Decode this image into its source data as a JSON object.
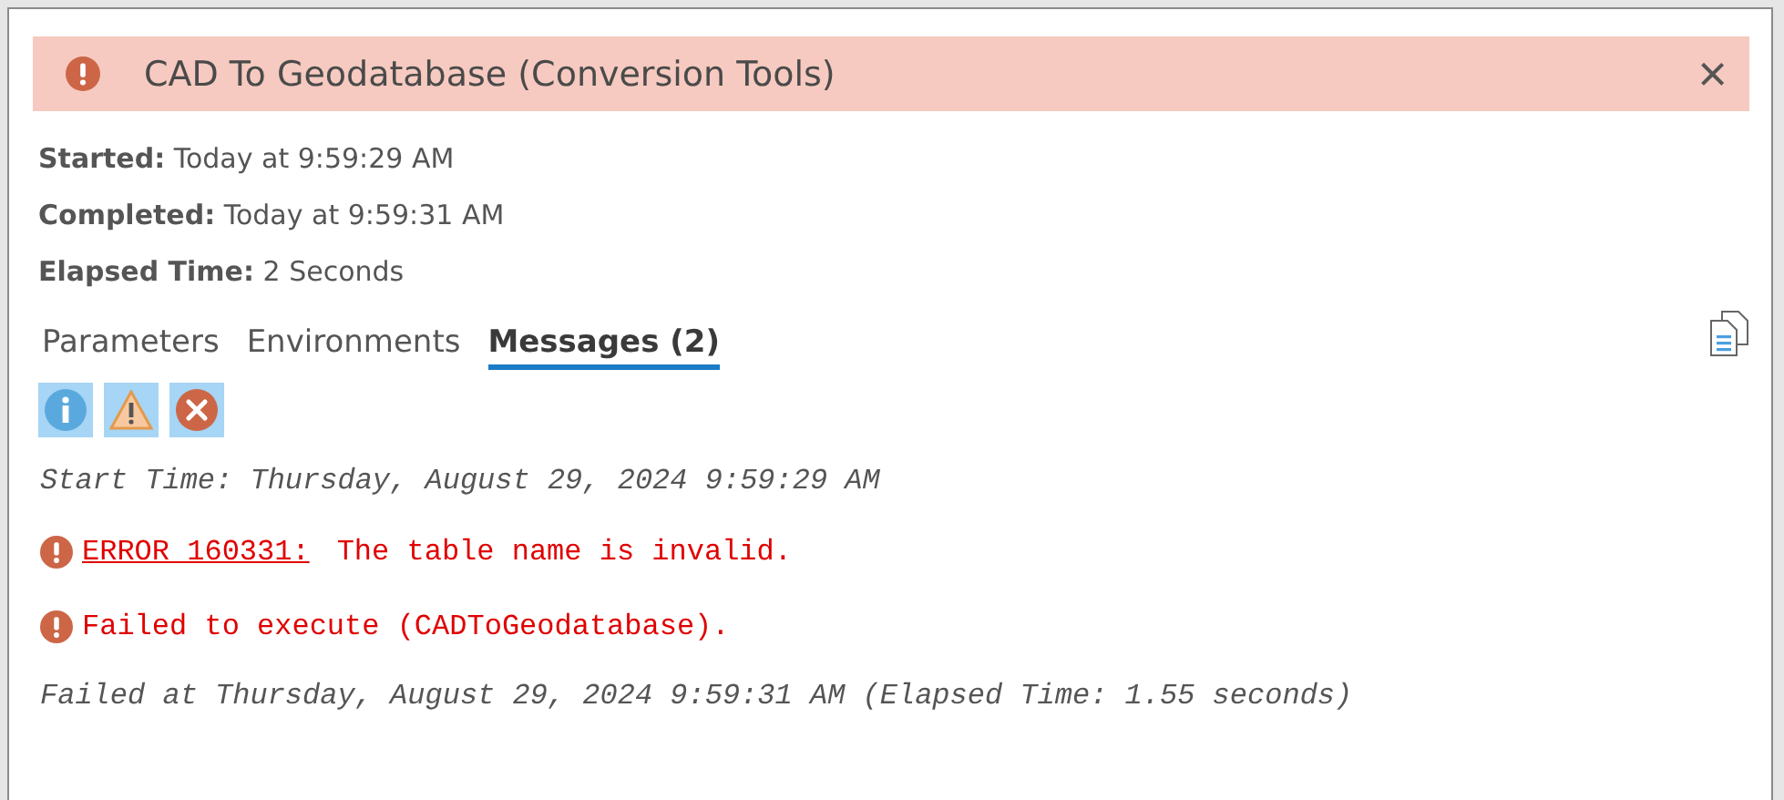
{
  "header": {
    "kind": "error",
    "title": "CAD To Geodatabase (Conversion Tools)",
    "close": "×"
  },
  "details": [
    {
      "label": "Started:",
      "value": "Today at 9:59:29 AM"
    },
    {
      "label": "Completed:",
      "value": "Today at 9:59:31 AM"
    },
    {
      "label": "Elapsed Time:",
      "value": "2 Seconds"
    }
  ],
  "tabs": [
    {
      "label": "Parameters",
      "selected": false
    },
    {
      "label": "Environments",
      "selected": false
    },
    {
      "label": "Messages (2)",
      "selected": true
    }
  ],
  "filters": [
    {
      "kind": "info",
      "on": true
    },
    {
      "kind": "warning",
      "on": true
    },
    {
      "kind": "error",
      "on": true
    }
  ],
  "messages": [
    {
      "kind": "info",
      "text": "Start Time: Thursday, August 29, 2024 9:59:29 AM"
    },
    {
      "kind": "error",
      "code": "ERROR 160331:",
      "text": "The table name is invalid."
    },
    {
      "kind": "error",
      "text": "Failed to execute (CADToGeodatabase)."
    },
    {
      "kind": "info",
      "text": "Failed at Thursday, August 29, 2024 9:59:31 AM (Elapsed Time: 1.55 seconds)"
    }
  ]
}
